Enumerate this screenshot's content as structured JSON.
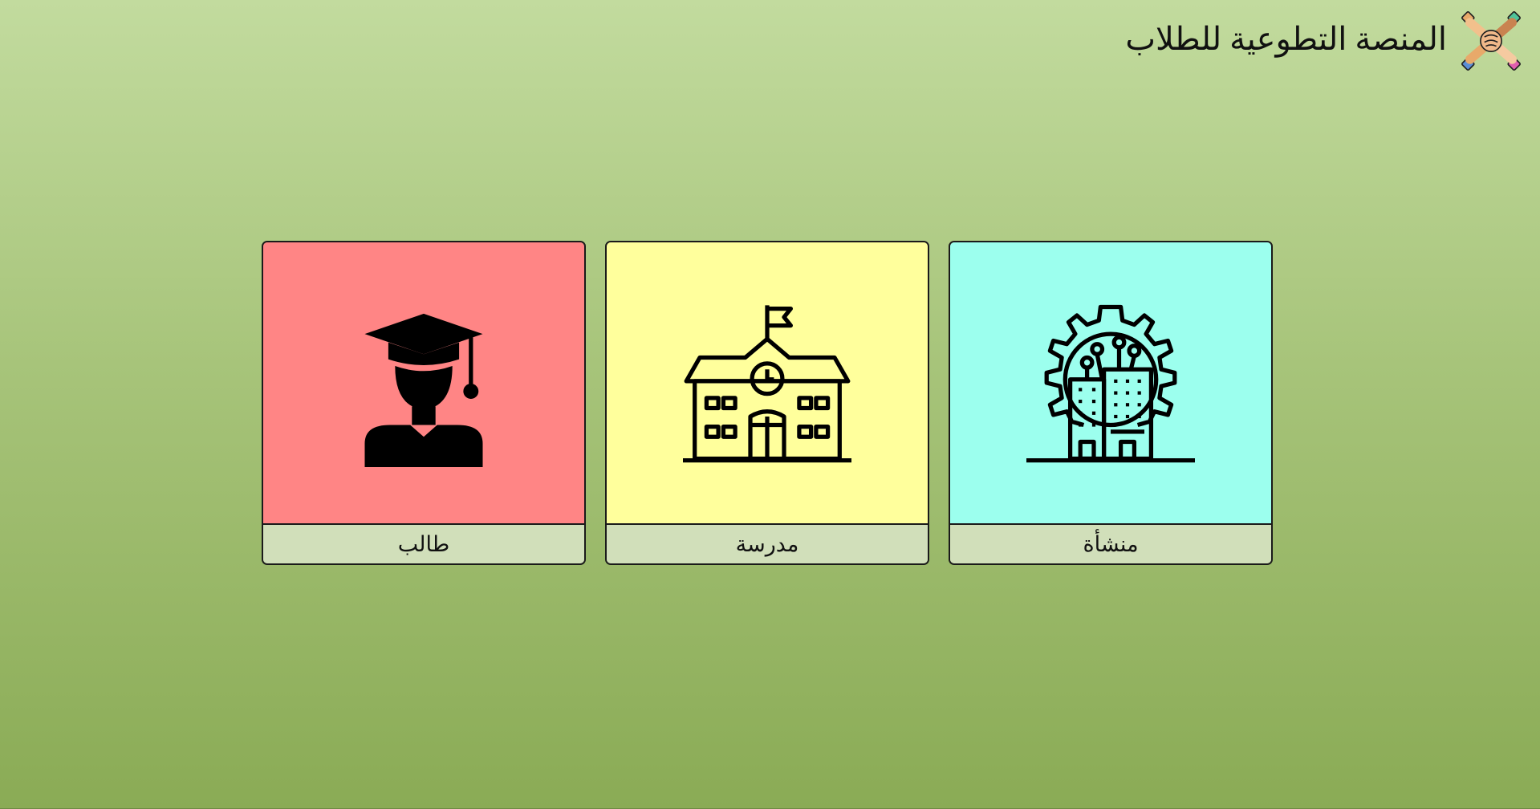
{
  "header": {
    "title": "المنصة التطوعية للطلاب",
    "logo_icon": "hands-together-logo-icon"
  },
  "cards": [
    {
      "label": "طالب",
      "icon": "graduate-student-icon",
      "color": "#ff8585"
    },
    {
      "label": "مدرسة",
      "icon": "school-building-icon",
      "color": "#ffff9c"
    },
    {
      "label": "منشأة",
      "icon": "gear-building-icon",
      "color": "#9cffee"
    }
  ],
  "colors": {
    "background_top": "#c2db9e",
    "background_bottom": "#8aab55",
    "label_bar": "#d1dfba"
  }
}
